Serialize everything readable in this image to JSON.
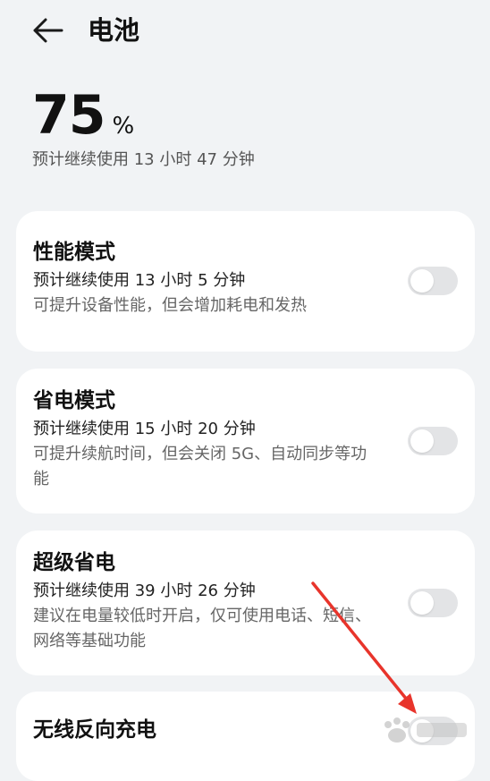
{
  "header": {
    "title": "电池"
  },
  "battery": {
    "value": "75",
    "unit": "%",
    "estimate": "预计继续使用 13 小时 47 分钟"
  },
  "cards": [
    {
      "title": "性能模式",
      "estimate": "预计继续使用 13 小时 5 分钟",
      "desc": "可提升设备性能，但会增加耗电和发热",
      "enabled": false
    },
    {
      "title": "省电模式",
      "estimate": "预计继续使用 15 小时 20 分钟",
      "desc": "可提升续航时间，但会关闭 5G、自动同步等功能",
      "enabled": false
    },
    {
      "title": "超级省电",
      "estimate": "预计继续使用 39 小时 26 分钟",
      "desc": "建议在电量较低时开启，仅可使用电话、短信、网络等基础功能",
      "enabled": false
    },
    {
      "title": "无线反向充电",
      "enabled": false
    }
  ],
  "colors": {
    "background": "#f1f3f5",
    "card": "#ffffff",
    "toggle_off": "#e3e4e6",
    "annotation_arrow": "#e8342b"
  }
}
